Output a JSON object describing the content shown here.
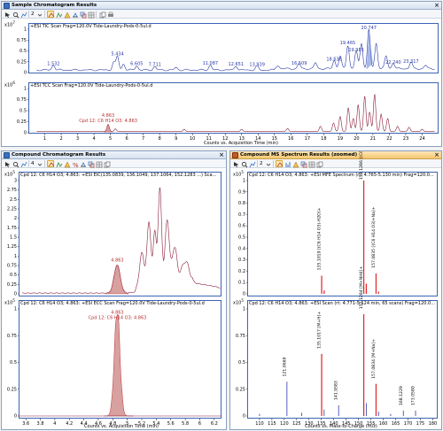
{
  "colors": {
    "trace_blue": "#2a3aa8",
    "trace_maroon": "#8a1f3a",
    "axis_blue": "#3c64b4",
    "peak_fill": "#d9a0a0",
    "bar_red": "#e0242a",
    "bar_blue": "#2a3aa8",
    "annot_red": "#b83232"
  },
  "top_panel": {
    "title": "Sample Chromatogram Results",
    "toolbar_number": "2",
    "plot1": {
      "scale_base": "x10",
      "scale_exp": "7",
      "label": "+ESI TIC Scan Frag=120.0V Tide-Laundry-Pods-0-5ul.d",
      "y_ticks": [
        "1",
        "0.75",
        "0.5",
        "0.25",
        "0"
      ],
      "peak_labels": [
        "1.532",
        "5.434",
        "6.605",
        "7.711",
        "11.087",
        "12.651",
        "13.939",
        "16.509",
        "18.636",
        "19.465",
        "19.985",
        "20.747",
        "22.240",
        "23.317"
      ]
    },
    "plot2": {
      "scale_base": "x10",
      "scale_exp": "6",
      "label": "+ESI TCC Scan Frag=120.0V Tide-Laundry-Pods-0-5ul.d",
      "y_ticks": [
        "1",
        "0.75",
        "0.5",
        "0.25",
        "0"
      ],
      "peak_label": "4.863",
      "compound_label": "Cpd 12: C6 H14 O3: 4.863"
    },
    "x_ticks": [
      "1",
      "2",
      "3",
      "4",
      "5",
      "6",
      "7",
      "8",
      "9",
      "10",
      "11",
      "12",
      "13",
      "14",
      "15",
      "16",
      "17",
      "18",
      "19",
      "20",
      "21",
      "22",
      "23",
      "24"
    ],
    "x_axis_label": "Counts vs. Acquisition Time (min)"
  },
  "left_panel": {
    "title": "Compound Chromatogram Results",
    "toolbar_number": "4",
    "plot1": {
      "scale_base": "x10",
      "scale_exp": "5",
      "label": "Cpd 12: C6 H14 O3; 4.863: +ESI EIC(135.0839, 136.1049, 137.1064, 152.1283 ...) Sca...",
      "y_ticks": [
        "3",
        "2.75",
        "2.5",
        "2.25",
        "2",
        "1.75",
        "1.5",
        "1.25",
        "1",
        "0.75",
        "0.5",
        "0.25",
        "0"
      ],
      "peak_label": "4.863"
    },
    "plot2": {
      "scale_base": "x10",
      "scale_exp": "5",
      "label": "Cpd 12: C6 H14 O3; 4.863: +ESI ECC Scan Frag=120.0V Tide-Laundry-Pods-0-5ul.d",
      "y_ticks": [
        "1",
        "0.75",
        "0.5",
        "0.25",
        "0"
      ],
      "peak_label": "4.863",
      "compound_label": "Cpd 12: C6 H14 O3: 4.863"
    },
    "x_ticks": [
      "3.6",
      "3.8",
      "4",
      "4.2",
      "4.4",
      "4.6",
      "4.8",
      "5",
      "5.2",
      "5.4",
      "5.6",
      "5.8",
      "6",
      "6.2"
    ],
    "x_axis_label": "Counts vs. Acquisition Time (min)"
  },
  "right_panel": {
    "title": "Compound MS Spectrum Results (zoomed)",
    "toolbar_number": "2",
    "plot1": {
      "scale_base": "x10",
      "scale_exp": "5",
      "label": "Cpd 12: C6 H14 O3; 4.863: +ESI MFE Spectrum (rt: 4.765-5.130 min) Frag=120.0...",
      "y_ticks": [
        "1",
        "0.9",
        "0.8",
        "0.7",
        "0.6",
        "0.5",
        "0.4",
        "0.3",
        "0.2",
        "0.1",
        "0"
      ],
      "bar_labels": [
        "135.1019 [(C6 H14 O3)-H2O]+",
        "152.1286 [(C6 H14 O3)+NH4]+",
        "157.0835 [(C6 H14 O3)+Na]+"
      ]
    },
    "plot2": {
      "scale_base": "x10",
      "scale_exp": "5",
      "label": "Cpd 12: C6 H14 O3; 4.863: +ESI Scan (rt: 4.771-5.124 min, 65 scans) Frag=120.0...",
      "y_ticks": [
        "1",
        "0.75",
        "0.5",
        "0.25",
        "0"
      ],
      "bar_labels": [
        "121.0669",
        "135.1017 [M+H]+",
        "141.9583",
        "152.1284 [M+NH4]+",
        "157.0834 [M+Na]+",
        "168.1229",
        "173.0580"
      ]
    },
    "x_ticks": [
      "110",
      "115",
      "120",
      "125",
      "130",
      "135",
      "140",
      "145",
      "150",
      "155",
      "160",
      "165",
      "170",
      "175",
      "180"
    ],
    "x_axis_label": "Counts vs. Mass-to-Charge (m/z)"
  }
}
